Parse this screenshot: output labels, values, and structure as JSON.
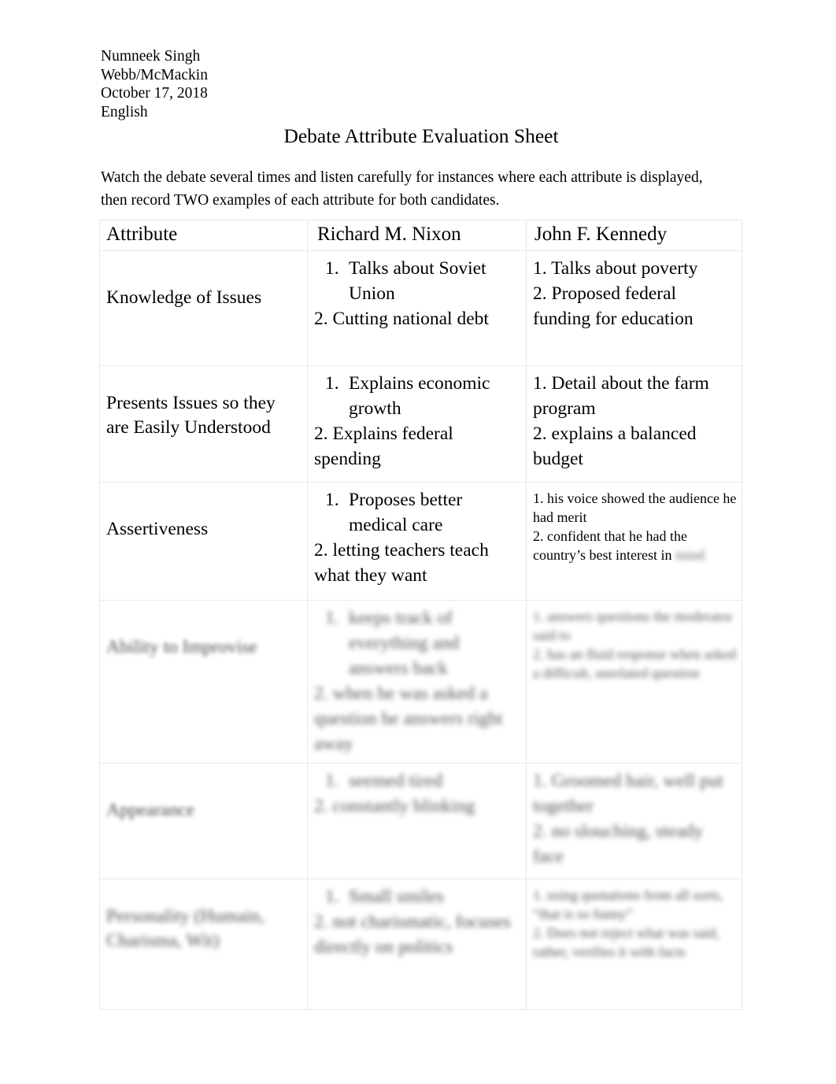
{
  "header": {
    "lines": [
      "Numneek Singh",
      "Webb/McMackin",
      "October 17, 2018",
      "English"
    ]
  },
  "title": "Debate Attribute Evaluation Sheet",
  "instructions": "Watch the debate several times and listen carefully for instances where each attribute is displayed, then record TWO examples of each attribute for both candidates.",
  "table": {
    "columns": [
      "Attribute",
      "Richard M. Nixon",
      "John F. Kennedy"
    ],
    "rows": [
      {
        "attribute": "Knowledge of Issues",
        "nixon": {
          "item1": "Talks about Soviet Union",
          "item2": "2. Cutting national debt"
        },
        "kennedy": {
          "item1": "1. Talks about poverty",
          "item2": "2. Proposed federal funding for education"
        },
        "legible": true
      },
      {
        "attribute": "Presents Issues so they are Easily Understood",
        "nixon": {
          "item1": "Explains economic growth",
          "item2": "2. Explains federal spending"
        },
        "kennedy": {
          "item1": "1. Detail about the farm program",
          "item2": "2. explains a balanced budget"
        },
        "legible": true
      },
      {
        "attribute": "Assertiveness",
        "nixon": {
          "item1": "Proposes better medical care",
          "item2": "2. letting teachers teach what they want"
        },
        "kennedy": {
          "item1": "1. his voice showed the audience he had merit",
          "item2": "2. confident that he had the country’s best interest in",
          "item2_blurred_tail": "mind"
        },
        "legible": true,
        "kennedy_small_text": true
      },
      {
        "attribute": "Ability to Improvise",
        "nixon": {
          "item1": "keeps track of everything and answers back",
          "item2": "2. when he was asked a question he answers right away"
        },
        "kennedy": {
          "item1": "1. answers questions the moderator said to",
          "item2": "2. has an fluid response when asked a difficult, unrelated question"
        },
        "legible": false
      },
      {
        "attribute": "Appearance",
        "nixon": {
          "item1": "seemed tired",
          "item2": "2. constantly blinking"
        },
        "kennedy": {
          "item1": "1. Groomed hair, well put together",
          "item2": "2. no slouching, steady face"
        },
        "legible": false
      },
      {
        "attribute": "Personality (Humain, Charisma, Wit)",
        "nixon": {
          "item1": "Small smiles",
          "item2": "2. not charismatic, focuses directly on politics"
        },
        "kennedy": {
          "item1": "1. using quotations from all sorts, “that is so funny”",
          "item2": "2. Does not reject what was said, rather, verifies it with facts"
        },
        "legible": false
      }
    ]
  }
}
